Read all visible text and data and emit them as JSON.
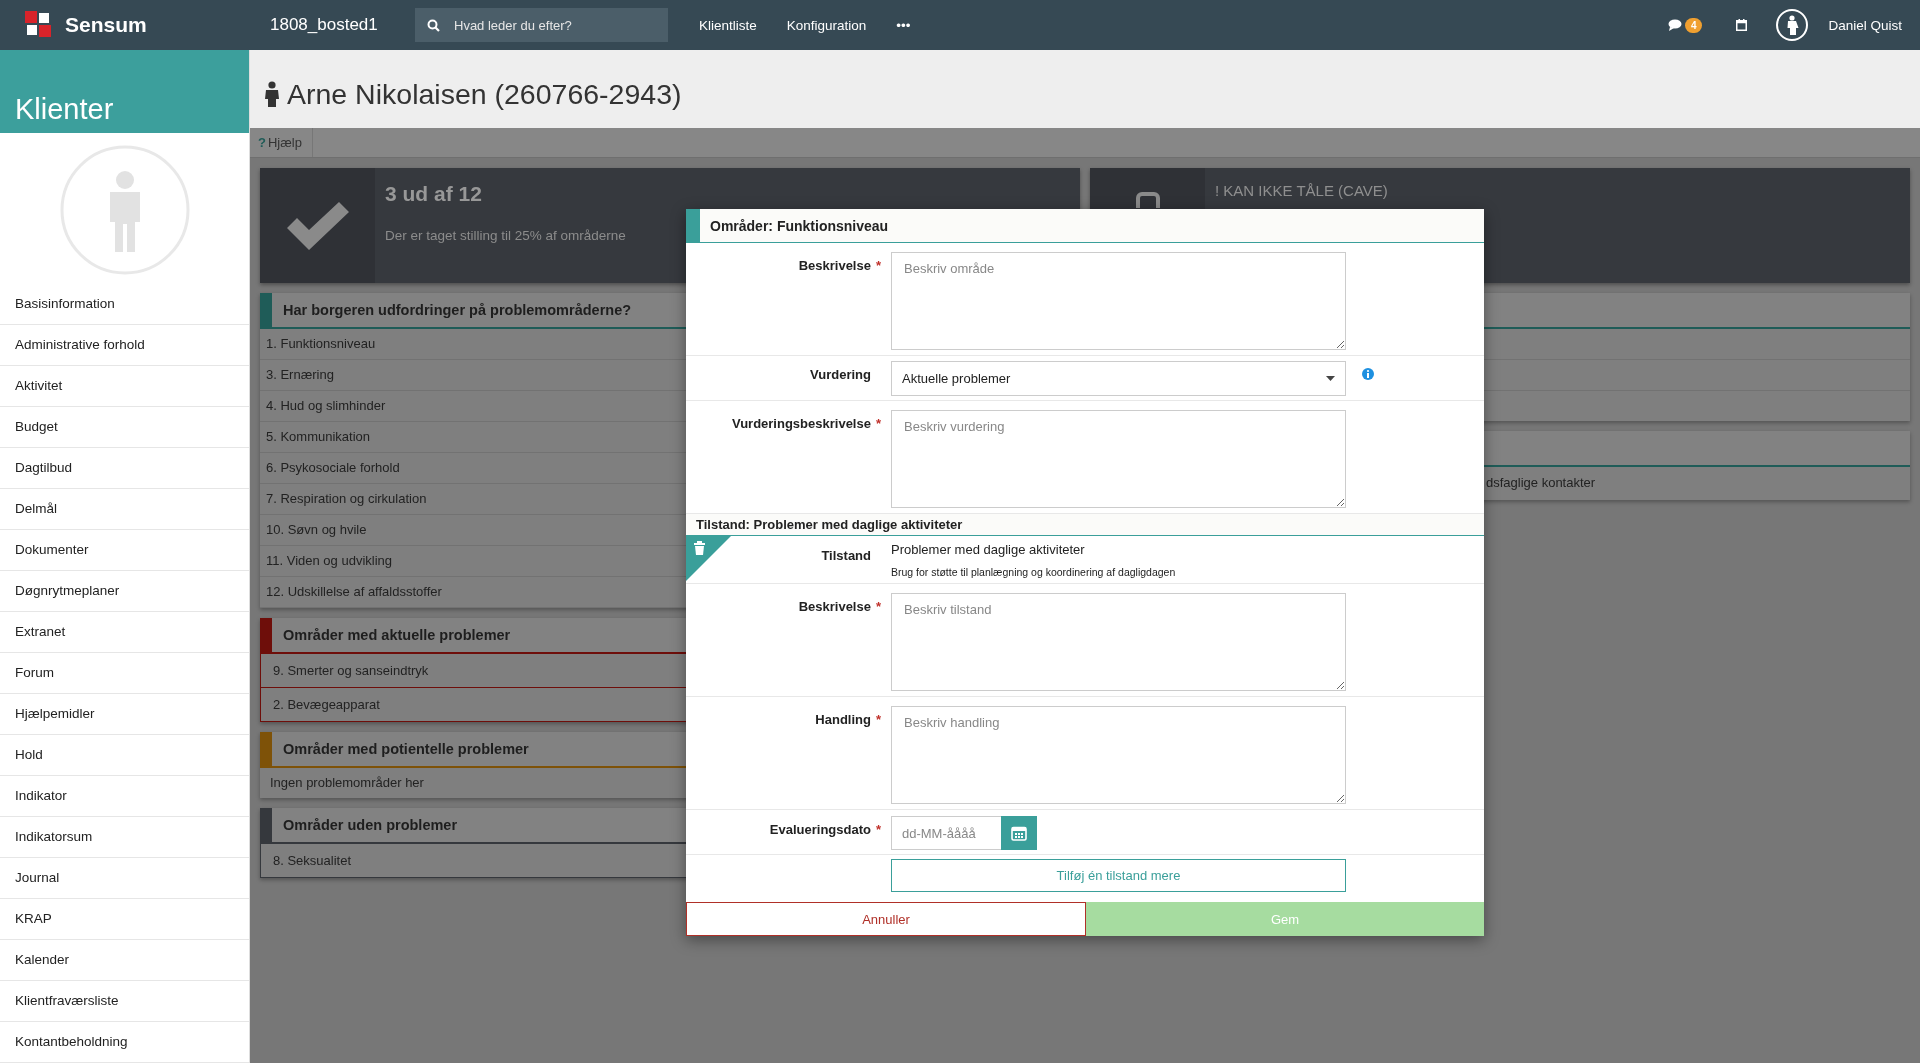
{
  "topbar": {
    "logo": "Sensum",
    "unit": "1808_bosted1",
    "search": {
      "placeholder": "Hvad leder du efter?"
    },
    "nav": [
      "Klientliste",
      "Konfiguration",
      "•••"
    ],
    "chat_badge": "4",
    "user": "Daniel Quist"
  },
  "sidebar": {
    "title": "Klienter",
    "items": [
      "Basisinformation",
      "Administrative forhold",
      "Aktivitet",
      "Budget",
      "Dagtilbud",
      "Delmål",
      "Dokumenter",
      "Døgnrytmeplaner",
      "Extranet",
      "Forum",
      "Hjælpemidler",
      "Hold",
      "Indikator",
      "Indikatorsum",
      "Journal",
      "KRAP",
      "Kalender",
      "Klientfraværsliste",
      "Kontantbeholdning"
    ]
  },
  "page": {
    "title": "Arne Nikolaisen (260766-2943)",
    "help_icon": "?",
    "help": "Hjælp"
  },
  "stats": {
    "title": "3 ud af 12",
    "text": "Der er taget stilling til 25% af områderne"
  },
  "groups": [
    {
      "title": "Har borgeren udfordringer på problemområderne?",
      "kind": "list",
      "color": "#1f5c58",
      "items": [
        "1. Funktionsniveau",
        "3. Ernæring",
        "4. Hud og slimhinder",
        "5. Kommunikation",
        "6. Psykosociale forhold",
        "7. Respiration og cirkulation",
        "10. Søvn og hvile",
        "11. Viden og udvikling",
        "12. Udskillelse af affaldsstoffer"
      ]
    },
    {
      "title": "Områder med aktuelle problemer",
      "kind": "bordered",
      "color": "#6e0e0a",
      "items": [
        "9. Smerter og sanseindtryk",
        "2. Bevægeapparat"
      ]
    },
    {
      "title": "Områder med potientelle problemer",
      "kind": "note",
      "color": "#7e5208",
      "items": [
        "Ingen problemområder her"
      ]
    },
    {
      "title": "Områder uden problemer",
      "kind": "bordered",
      "color": "#35383d",
      "items": [
        "8. Seksualitet"
      ]
    }
  ],
  "cave": {
    "title": "! KAN IKKE TÅLE (CAVE)"
  },
  "contacts": {
    "row": "dsfaglige kontakter"
  },
  "modal": {
    "title": "Områder: Funktionsniveau",
    "fields": [
      {
        "kind": "textarea",
        "label": "Beskrivelse",
        "required_mark": "*",
        "placeholder": "Beskriv område"
      },
      {
        "kind": "select",
        "label": "Vurdering",
        "value": "Aktuelle problemer",
        "info": true
      },
      {
        "kind": "textarea",
        "label": "Vurderingsbeskrivelse",
        "required_mark": "*",
        "placeholder": "Beskriv vurdering"
      }
    ],
    "state_section": {
      "title": "Tilstand: Problemer med daglige aktiviteter",
      "label": "Tilstand",
      "value": "Problemer med daglige aktiviteter",
      "hint": "Brug for støtte til planlægning og koordinering af dagligdagen",
      "fields": [
        {
          "kind": "textarea",
          "label": "Beskrivelse",
          "required_mark": "*",
          "placeholder": "Beskriv tilstand"
        },
        {
          "kind": "textarea",
          "label": "Handling",
          "required_mark": "*",
          "placeholder": "Beskriv handling"
        },
        {
          "kind": "date",
          "label": "Evalueringsdato",
          "required_mark": "*",
          "placeholder": "dd-MM-åååå"
        }
      ]
    },
    "add_button": "Tilføj én tilstand mere",
    "cancel": "Annuller",
    "save": "Gem"
  }
}
